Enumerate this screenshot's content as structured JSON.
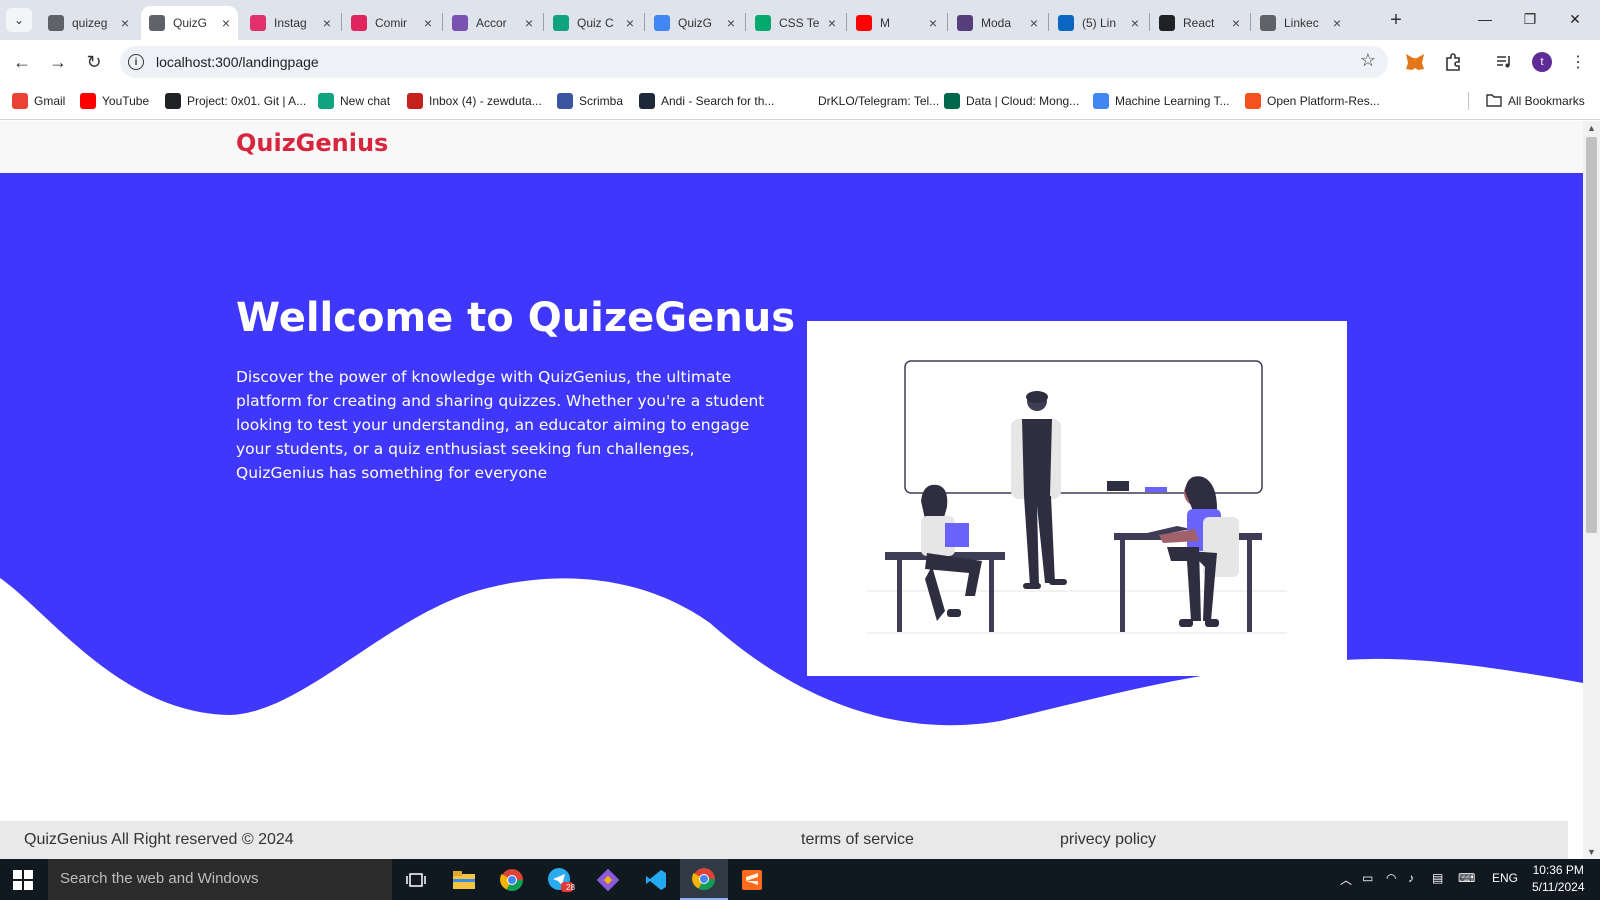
{
  "browser": {
    "tabs": [
      {
        "title": "quizeg",
        "icon": "globe-icon",
        "color": "#5f6368",
        "active": false
      },
      {
        "title": "QuizG",
        "icon": "globe-icon",
        "color": "#5f6368",
        "active": true
      },
      {
        "title": "Instag",
        "icon": "instagram-icon",
        "color": "#e1306c",
        "active": false
      },
      {
        "title": "Comir",
        "icon": "comic-icon",
        "color": "#e0245e",
        "active": false
      },
      {
        "title": "Accor",
        "icon": "bootstrap-icon",
        "color": "#7952b3",
        "active": false
      },
      {
        "title": "Quiz C",
        "icon": "chatgpt-icon",
        "color": "#10a37f",
        "active": false
      },
      {
        "title": "QuizG",
        "icon": "docs-icon",
        "color": "#4285f4",
        "active": false
      },
      {
        "title": "CSS Te",
        "icon": "w3schools-icon",
        "color": "#04aa6d",
        "active": false
      },
      {
        "title": "M",
        "icon": "youtube-icon",
        "color": "#ff0000",
        "active": false
      },
      {
        "title": "Moda",
        "icon": "bootstrap-icon",
        "color": "#563d7c",
        "active": false
      },
      {
        "title": "(5) Lin",
        "icon": "linkedin-icon",
        "color": "#0a66c2",
        "active": false
      },
      {
        "title": "React",
        "icon": "rxjs-icon",
        "color": "#202124",
        "active": false
      },
      {
        "title": "Linkec",
        "icon": "globe-icon",
        "color": "#5f6368",
        "active": false
      }
    ],
    "url": "localhost:300/landingpage",
    "profile_initial": "t",
    "bookmarks": [
      {
        "label": "Gmail",
        "icon": "gmail-icon",
        "color": "#ea4335"
      },
      {
        "label": "YouTube",
        "icon": "youtube-icon",
        "color": "#ff0000"
      },
      {
        "label": "Project: 0x01. Git | A...",
        "icon": "alx-icon",
        "color": "#202124"
      },
      {
        "label": "New chat",
        "icon": "chatgpt-icon",
        "color": "#10a37f"
      },
      {
        "label": "Inbox (4) - zewduta...",
        "icon": "gmail-icon",
        "color": "#c5221f"
      },
      {
        "label": "Scrimba",
        "icon": "scrimba-icon",
        "color": "#3b55a1"
      },
      {
        "label": "Andi - Search for th...",
        "icon": "andi-icon",
        "color": "#1d2939"
      },
      {
        "label": "DrKLO/Telegram: Tel...",
        "icon": "github-icon",
        "color": "#ffffff"
      },
      {
        "label": "Data | Cloud: Mong...",
        "icon": "mongodb-icon",
        "color": "#00684a"
      },
      {
        "label": "Machine Learning T...",
        "icon": "docs-icon",
        "color": "#4285f4"
      },
      {
        "label": "Open Platform-Res...",
        "icon": "openplatform-icon",
        "color": "#f4511e"
      }
    ],
    "all_bookmarks_label": "All Bookmarks"
  },
  "page": {
    "brand": "QuizGenius",
    "hero_title": "Wellcome to QuizeGenus",
    "hero_text": "Discover the power of knowledge with QuizGenius, the ultimate platform for creating and sharing quizzes. Whether you're a student looking to test your understanding, an educator aiming to engage your students, or a quiz enthusiast seeking fun challenges, QuizGenius has something for everyone",
    "footer_copy": "QuizGenius All Right reserved © 2024",
    "footer_terms": "terms of service",
    "footer_privacy": "privecy policy",
    "colors": {
      "hero_bg": "#3f37fb",
      "brand": "#d7263d",
      "accent": "#6c63ff",
      "footer_bg": "#e9e9e9"
    }
  },
  "taskbar": {
    "search_placeholder": "Search the web and Windows",
    "telegram_badge": "28",
    "language": "ENG",
    "time": "10:36 PM",
    "date": "5/11/2024"
  }
}
